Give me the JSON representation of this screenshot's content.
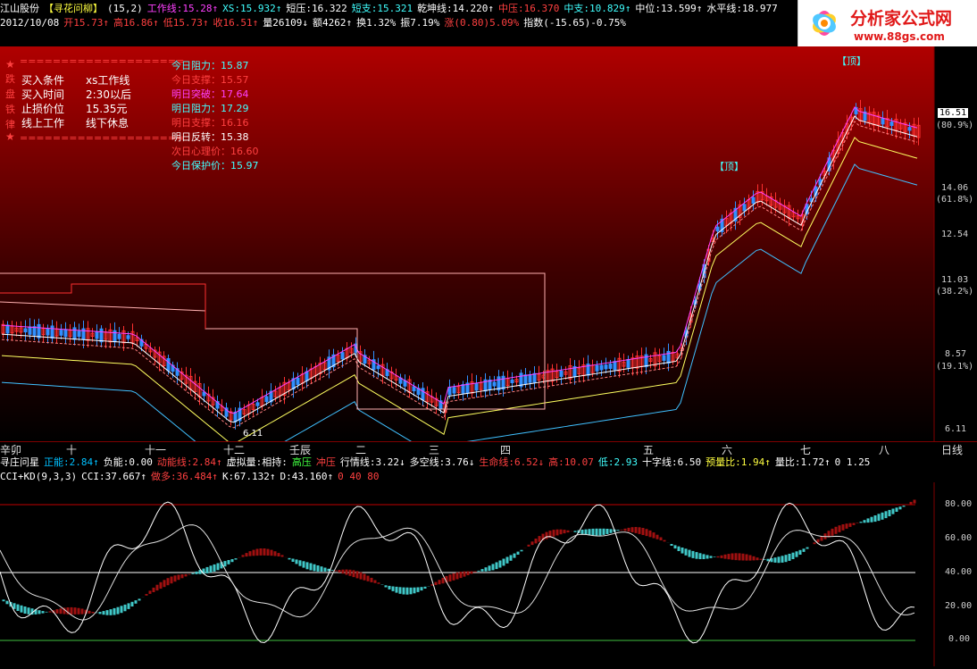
{
  "header": {
    "line1": [
      {
        "t": "江山股份",
        "c": "w"
      },
      {
        "t": "【寻花问柳】",
        "c": "y"
      },
      {
        "t": "(15,2)",
        "c": "w"
      },
      {
        "t": "工作线:15.28↑",
        "c": "m"
      },
      {
        "t": "XS:15.932↑",
        "c": "c"
      },
      {
        "t": "短压:16.322",
        "c": "w"
      },
      {
        "t": "短支:15.321",
        "c": "c"
      },
      {
        "t": "乾坤线:14.220↑",
        "c": "w"
      },
      {
        "t": "中压:16.370",
        "c": "r"
      },
      {
        "t": "中支:10.829↑",
        "c": "c"
      },
      {
        "t": "中位:13.599↑",
        "c": "w"
      },
      {
        "t": "水平线:18.977",
        "c": "w"
      }
    ],
    "line2": [
      {
        "t": "2012/10/08",
        "c": "w"
      },
      {
        "t": "开15.73↑",
        "c": "r"
      },
      {
        "t": "高16.86↑",
        "c": "r"
      },
      {
        "t": "低15.73↑",
        "c": "r"
      },
      {
        "t": "收16.51↑",
        "c": "r"
      },
      {
        "t": "量26109↓",
        "c": "w"
      },
      {
        "t": "额4262↑",
        "c": "w"
      },
      {
        "t": "换1.32%",
        "c": "w"
      },
      {
        "t": "振7.19%",
        "c": "w"
      },
      {
        "t": "涨(0.80)5.09%",
        "c": "r"
      },
      {
        "t": "指数(-15.65)-0.75%",
        "c": "w"
      }
    ]
  },
  "logo": {
    "title": "分析家公式网",
    "url": "www.88gs.com"
  },
  "strategy_box": {
    "rows": [
      {
        "k": "买入条件",
        "v": "xs工作线"
      },
      {
        "k": "买入时间",
        "v": "2:30以后"
      },
      {
        "k": "止损价位",
        "v": "15.35元"
      },
      {
        "k": "线上工作",
        "v": "线下休息"
      }
    ],
    "stars": "★",
    "side_text": [
      "跌",
      "盘",
      "铁",
      "律"
    ],
    "divider": "===================="
  },
  "levels": [
    {
      "t": "今日阻力：15.87",
      "c": "c"
    },
    {
      "t": "今日支撑：15.57",
      "c": "r"
    },
    {
      "t": "明日突破：17.64",
      "c": "m"
    },
    {
      "t": "明日阻力：17.29",
      "c": "c"
    },
    {
      "t": "明日支撑：16.16",
      "c": "r"
    },
    {
      "t": "明日反转：15.38",
      "c": "w"
    },
    {
      "t": "次日心理价：16.60",
      "c": "r"
    },
    {
      "t": "今日保护价：15.97",
      "c": "c"
    }
  ],
  "chart_labels": {
    "top1": "【顶】",
    "top2": "【顶】",
    "low": "6.11"
  },
  "price_axis": [
    "16.51",
    "(80.9%)",
    "14.06",
    "(61.8%)",
    "12.54",
    "11.03",
    "(38.2%)",
    "8.57",
    "(19.1%)",
    "6.11"
  ],
  "time_axis": [
    "辛卯",
    "十",
    "十一",
    "十二",
    "壬辰",
    "二",
    "三",
    "四",
    "五",
    "六",
    "七",
    "八"
  ],
  "daily_label": "日线",
  "indicator_line": [
    {
      "t": "寻庄问星",
      "c": "w"
    },
    {
      "t": "正能:2.84↑",
      "c": "b"
    },
    {
      "t": "负能:0.00",
      "c": "w"
    },
    {
      "t": "动能线:2.84↑",
      "c": "r"
    },
    {
      "t": "虚拟量:相持:",
      "c": "w"
    },
    {
      "t": "高压",
      "c": "g"
    },
    {
      "t": "冲压",
      "c": "r"
    },
    {
      "t": "行情线:3.22↓",
      "c": "w"
    },
    {
      "t": "多空线:3.76↓",
      "c": "w"
    },
    {
      "t": "生命线:6.52↓",
      "c": "r"
    },
    {
      "t": "高:10.07",
      "c": "r"
    },
    {
      "t": "低:2.93",
      "c": "c"
    },
    {
      "t": "十字线:6.50",
      "c": "w"
    },
    {
      "t": "预量比:1.94↑",
      "c": "y"
    },
    {
      "t": "量比:1.72↑",
      "c": "w"
    },
    {
      "t": "0 1.25",
      "c": "w"
    }
  ],
  "cci_line": [
    {
      "t": "CCI+KD(9,3,3)",
      "c": "w"
    },
    {
      "t": "CCI:37.667↑",
      "c": "w"
    },
    {
      "t": "做多:36.484↑",
      "c": "r"
    },
    {
      "t": "K:67.132↑",
      "c": "w"
    },
    {
      "t": "D:43.160↑",
      "c": "w"
    },
    {
      "t": "0 40 80",
      "c": "r"
    }
  ],
  "sub_axis": [
    "80.00",
    "60.00",
    "40.00",
    "20.00",
    "0.00"
  ],
  "colors": {
    "bg_top": "#c00000",
    "bg_bottom": "#000000",
    "up": "#ff3030",
    "down": "#3090ff"
  }
}
